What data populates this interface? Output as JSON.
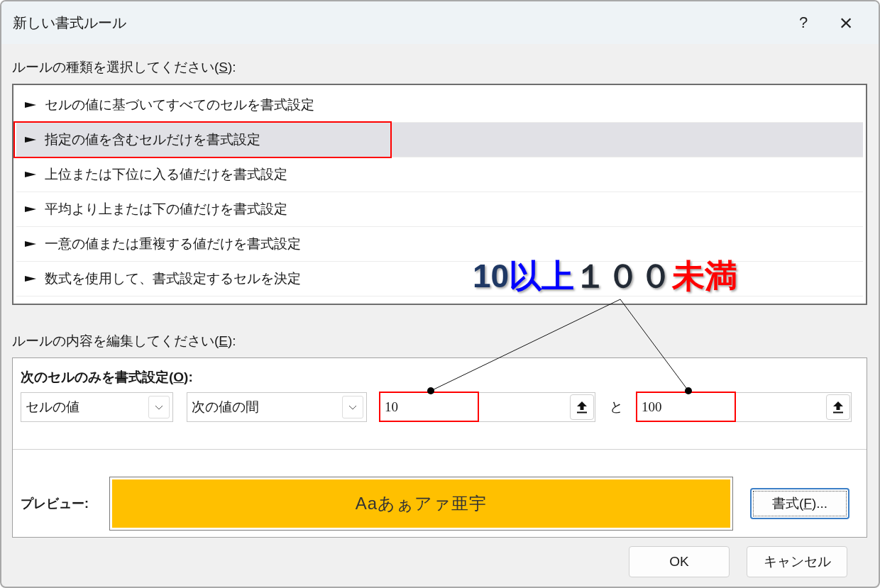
{
  "window": {
    "title": "新しい書式ルール",
    "help": "?",
    "close": "×"
  },
  "rule_type_label": {
    "prefix": "ルールの種類を選択してください(",
    "accesskey": "S",
    "suffix": "):"
  },
  "rule_types": [
    {
      "label": "セルの値に基づいてすべてのセルを書式設定",
      "selected": false,
      "highlighted": false
    },
    {
      "label": "指定の値を含むセルだけを書式設定",
      "selected": true,
      "highlighted": true
    },
    {
      "label": "上位または下位に入る値だけを書式設定",
      "selected": false,
      "highlighted": false
    },
    {
      "label": "平均より上または下の値だけを書式設定",
      "selected": false,
      "highlighted": false
    },
    {
      "label": "一意の値または重複する値だけを書式設定",
      "selected": false,
      "highlighted": false
    },
    {
      "label": "数式を使用して、書式設定するセルを決定",
      "selected": false,
      "highlighted": false
    }
  ],
  "edit_label": {
    "prefix": "ルールの内容を編集してください(",
    "accesskey": "E",
    "suffix": "):"
  },
  "condition_heading": {
    "prefix": "次のセルのみを書式設定(",
    "accesskey": "O",
    "suffix": "):"
  },
  "condition": {
    "dropdown_1": "セルの値",
    "dropdown_2": "次の値の間",
    "value_1": {
      "value": "10",
      "highlighted": true
    },
    "joiner": "と",
    "value_2": {
      "value": "100",
      "highlighted": true
    }
  },
  "preview": {
    "label": "プレビュー:",
    "sample": "Aaあぁアァ亜宇",
    "format_button": {
      "prefix": "書式(",
      "accesskey": "F",
      "suffix": ")..."
    }
  },
  "buttons": [
    "OK",
    "キャンセル"
  ],
  "annotation": {
    "segments": [
      {
        "text": "10",
        "color": "#1f3864"
      },
      {
        "text": "以上",
        "color": "#0000ff"
      },
      {
        "text": "１００",
        "color": "#222a35"
      },
      {
        "text": "未満",
        "color": "#ff0000"
      }
    ]
  }
}
